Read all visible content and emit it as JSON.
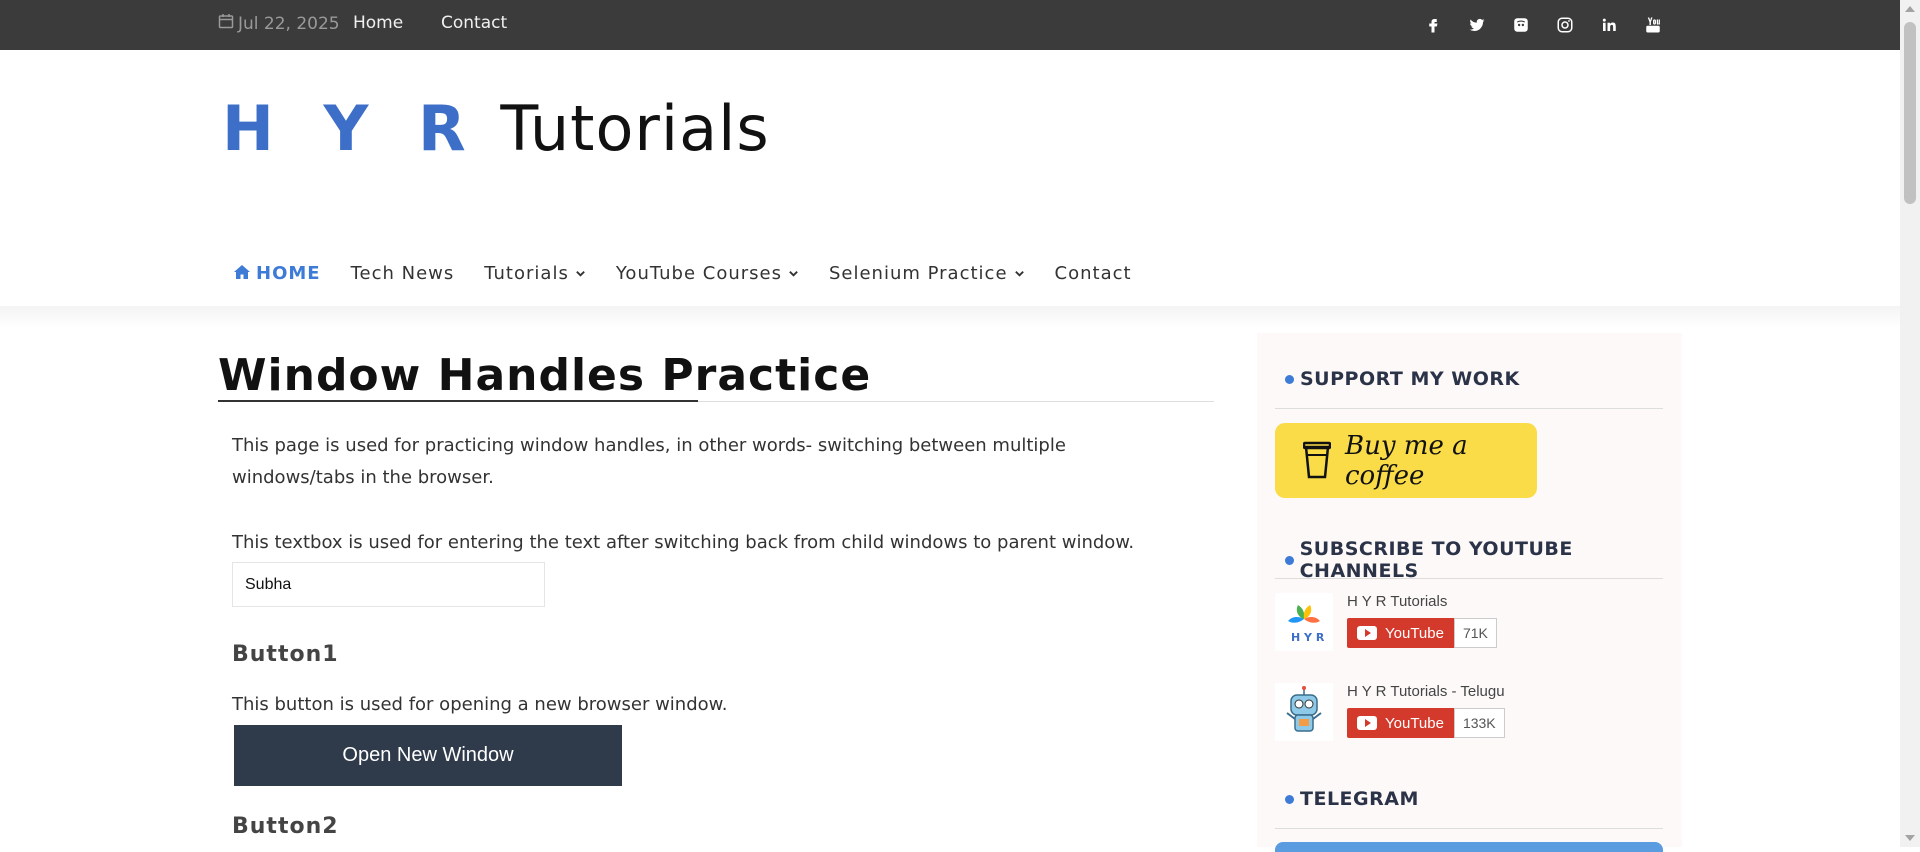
{
  "topbar": {
    "date": "Jul 22, 2025",
    "links": [
      "Home",
      "Contact"
    ],
    "social_icons": [
      "facebook-icon",
      "twitter-icon",
      "discord-icon",
      "instagram-icon",
      "linkedin-icon",
      "youtube-icon"
    ]
  },
  "logo": {
    "part1": "H Y R",
    "part2": "Tutorials"
  },
  "nav": {
    "home": "HOME",
    "tech_news": "Tech News",
    "tutorials": "Tutorials",
    "youtube_courses": "YouTube Courses",
    "selenium_practice": "Selenium Practice",
    "contact": "Contact"
  },
  "main": {
    "title": "Window Handles Practice",
    "intro": "This page is used for practicing window handles, in other words- switching between multiple windows/tabs in the browser.",
    "textbox_desc": "This textbox is used for entering the text after switching back from child windows to parent window.",
    "textbox_value": "Subha",
    "button1_heading": "Button1",
    "button1_desc": "This button is used for opening a new browser window.",
    "button1_label": "Open New Window",
    "button2_heading": "Button2"
  },
  "sidebar": {
    "support_title": "SUPPORT MY WORK",
    "coffee_label": "Buy me a coffee",
    "subscribe_title": "SUBSCRIBE TO YOUTUBE CHANNELS",
    "channels": [
      {
        "name": "H Y R Tutorials",
        "button": "YouTube",
        "count": "71K"
      },
      {
        "name": "H Y R Tutorials - Telugu",
        "button": "YouTube",
        "count": "133K"
      }
    ],
    "telegram_title": "TELEGRAM"
  },
  "colors": {
    "topbar": "#3b3b3b",
    "accent": "#3d7bd7",
    "button": "#2f3a4b",
    "coffee": "#f9dc48",
    "youtube_red": "#d33a2c"
  }
}
